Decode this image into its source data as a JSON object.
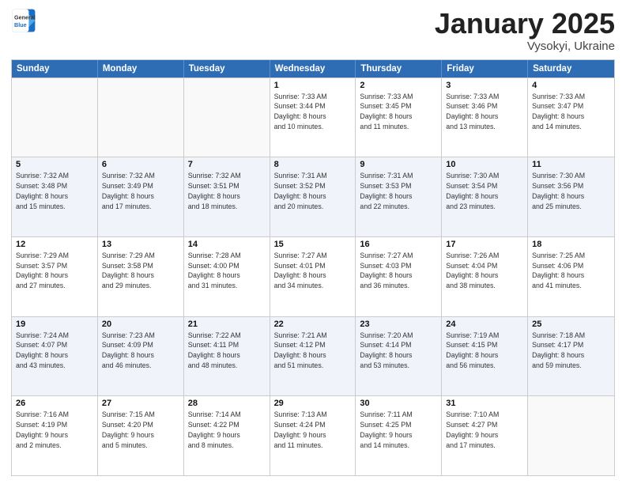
{
  "header": {
    "logo": {
      "line1": "General",
      "line2": "Blue"
    },
    "title": "January 2025",
    "location": "Vysokyi, Ukraine"
  },
  "weekdays": [
    "Sunday",
    "Monday",
    "Tuesday",
    "Wednesday",
    "Thursday",
    "Friday",
    "Saturday"
  ],
  "rows": [
    [
      {
        "day": "",
        "info": "",
        "empty": true
      },
      {
        "day": "",
        "info": "",
        "empty": true
      },
      {
        "day": "",
        "info": "",
        "empty": true
      },
      {
        "day": "1",
        "info": "Sunrise: 7:33 AM\nSunset: 3:44 PM\nDaylight: 8 hours\nand 10 minutes."
      },
      {
        "day": "2",
        "info": "Sunrise: 7:33 AM\nSunset: 3:45 PM\nDaylight: 8 hours\nand 11 minutes."
      },
      {
        "day": "3",
        "info": "Sunrise: 7:33 AM\nSunset: 3:46 PM\nDaylight: 8 hours\nand 13 minutes."
      },
      {
        "day": "4",
        "info": "Sunrise: 7:33 AM\nSunset: 3:47 PM\nDaylight: 8 hours\nand 14 minutes."
      }
    ],
    [
      {
        "day": "5",
        "info": "Sunrise: 7:32 AM\nSunset: 3:48 PM\nDaylight: 8 hours\nand 15 minutes."
      },
      {
        "day": "6",
        "info": "Sunrise: 7:32 AM\nSunset: 3:49 PM\nDaylight: 8 hours\nand 17 minutes."
      },
      {
        "day": "7",
        "info": "Sunrise: 7:32 AM\nSunset: 3:51 PM\nDaylight: 8 hours\nand 18 minutes."
      },
      {
        "day": "8",
        "info": "Sunrise: 7:31 AM\nSunset: 3:52 PM\nDaylight: 8 hours\nand 20 minutes."
      },
      {
        "day": "9",
        "info": "Sunrise: 7:31 AM\nSunset: 3:53 PM\nDaylight: 8 hours\nand 22 minutes."
      },
      {
        "day": "10",
        "info": "Sunrise: 7:30 AM\nSunset: 3:54 PM\nDaylight: 8 hours\nand 23 minutes."
      },
      {
        "day": "11",
        "info": "Sunrise: 7:30 AM\nSunset: 3:56 PM\nDaylight: 8 hours\nand 25 minutes."
      }
    ],
    [
      {
        "day": "12",
        "info": "Sunrise: 7:29 AM\nSunset: 3:57 PM\nDaylight: 8 hours\nand 27 minutes."
      },
      {
        "day": "13",
        "info": "Sunrise: 7:29 AM\nSunset: 3:58 PM\nDaylight: 8 hours\nand 29 minutes."
      },
      {
        "day": "14",
        "info": "Sunrise: 7:28 AM\nSunset: 4:00 PM\nDaylight: 8 hours\nand 31 minutes."
      },
      {
        "day": "15",
        "info": "Sunrise: 7:27 AM\nSunset: 4:01 PM\nDaylight: 8 hours\nand 34 minutes."
      },
      {
        "day": "16",
        "info": "Sunrise: 7:27 AM\nSunset: 4:03 PM\nDaylight: 8 hours\nand 36 minutes."
      },
      {
        "day": "17",
        "info": "Sunrise: 7:26 AM\nSunset: 4:04 PM\nDaylight: 8 hours\nand 38 minutes."
      },
      {
        "day": "18",
        "info": "Sunrise: 7:25 AM\nSunset: 4:06 PM\nDaylight: 8 hours\nand 41 minutes."
      }
    ],
    [
      {
        "day": "19",
        "info": "Sunrise: 7:24 AM\nSunset: 4:07 PM\nDaylight: 8 hours\nand 43 minutes."
      },
      {
        "day": "20",
        "info": "Sunrise: 7:23 AM\nSunset: 4:09 PM\nDaylight: 8 hours\nand 46 minutes."
      },
      {
        "day": "21",
        "info": "Sunrise: 7:22 AM\nSunset: 4:11 PM\nDaylight: 8 hours\nand 48 minutes."
      },
      {
        "day": "22",
        "info": "Sunrise: 7:21 AM\nSunset: 4:12 PM\nDaylight: 8 hours\nand 51 minutes."
      },
      {
        "day": "23",
        "info": "Sunrise: 7:20 AM\nSunset: 4:14 PM\nDaylight: 8 hours\nand 53 minutes."
      },
      {
        "day": "24",
        "info": "Sunrise: 7:19 AM\nSunset: 4:15 PM\nDaylight: 8 hours\nand 56 minutes."
      },
      {
        "day": "25",
        "info": "Sunrise: 7:18 AM\nSunset: 4:17 PM\nDaylight: 8 hours\nand 59 minutes."
      }
    ],
    [
      {
        "day": "26",
        "info": "Sunrise: 7:16 AM\nSunset: 4:19 PM\nDaylight: 9 hours\nand 2 minutes."
      },
      {
        "day": "27",
        "info": "Sunrise: 7:15 AM\nSunset: 4:20 PM\nDaylight: 9 hours\nand 5 minutes."
      },
      {
        "day": "28",
        "info": "Sunrise: 7:14 AM\nSunset: 4:22 PM\nDaylight: 9 hours\nand 8 minutes."
      },
      {
        "day": "29",
        "info": "Sunrise: 7:13 AM\nSunset: 4:24 PM\nDaylight: 9 hours\nand 11 minutes."
      },
      {
        "day": "30",
        "info": "Sunrise: 7:11 AM\nSunset: 4:25 PM\nDaylight: 9 hours\nand 14 minutes."
      },
      {
        "day": "31",
        "info": "Sunrise: 7:10 AM\nSunset: 4:27 PM\nDaylight: 9 hours\nand 17 minutes."
      },
      {
        "day": "",
        "info": "",
        "empty": true
      }
    ]
  ]
}
